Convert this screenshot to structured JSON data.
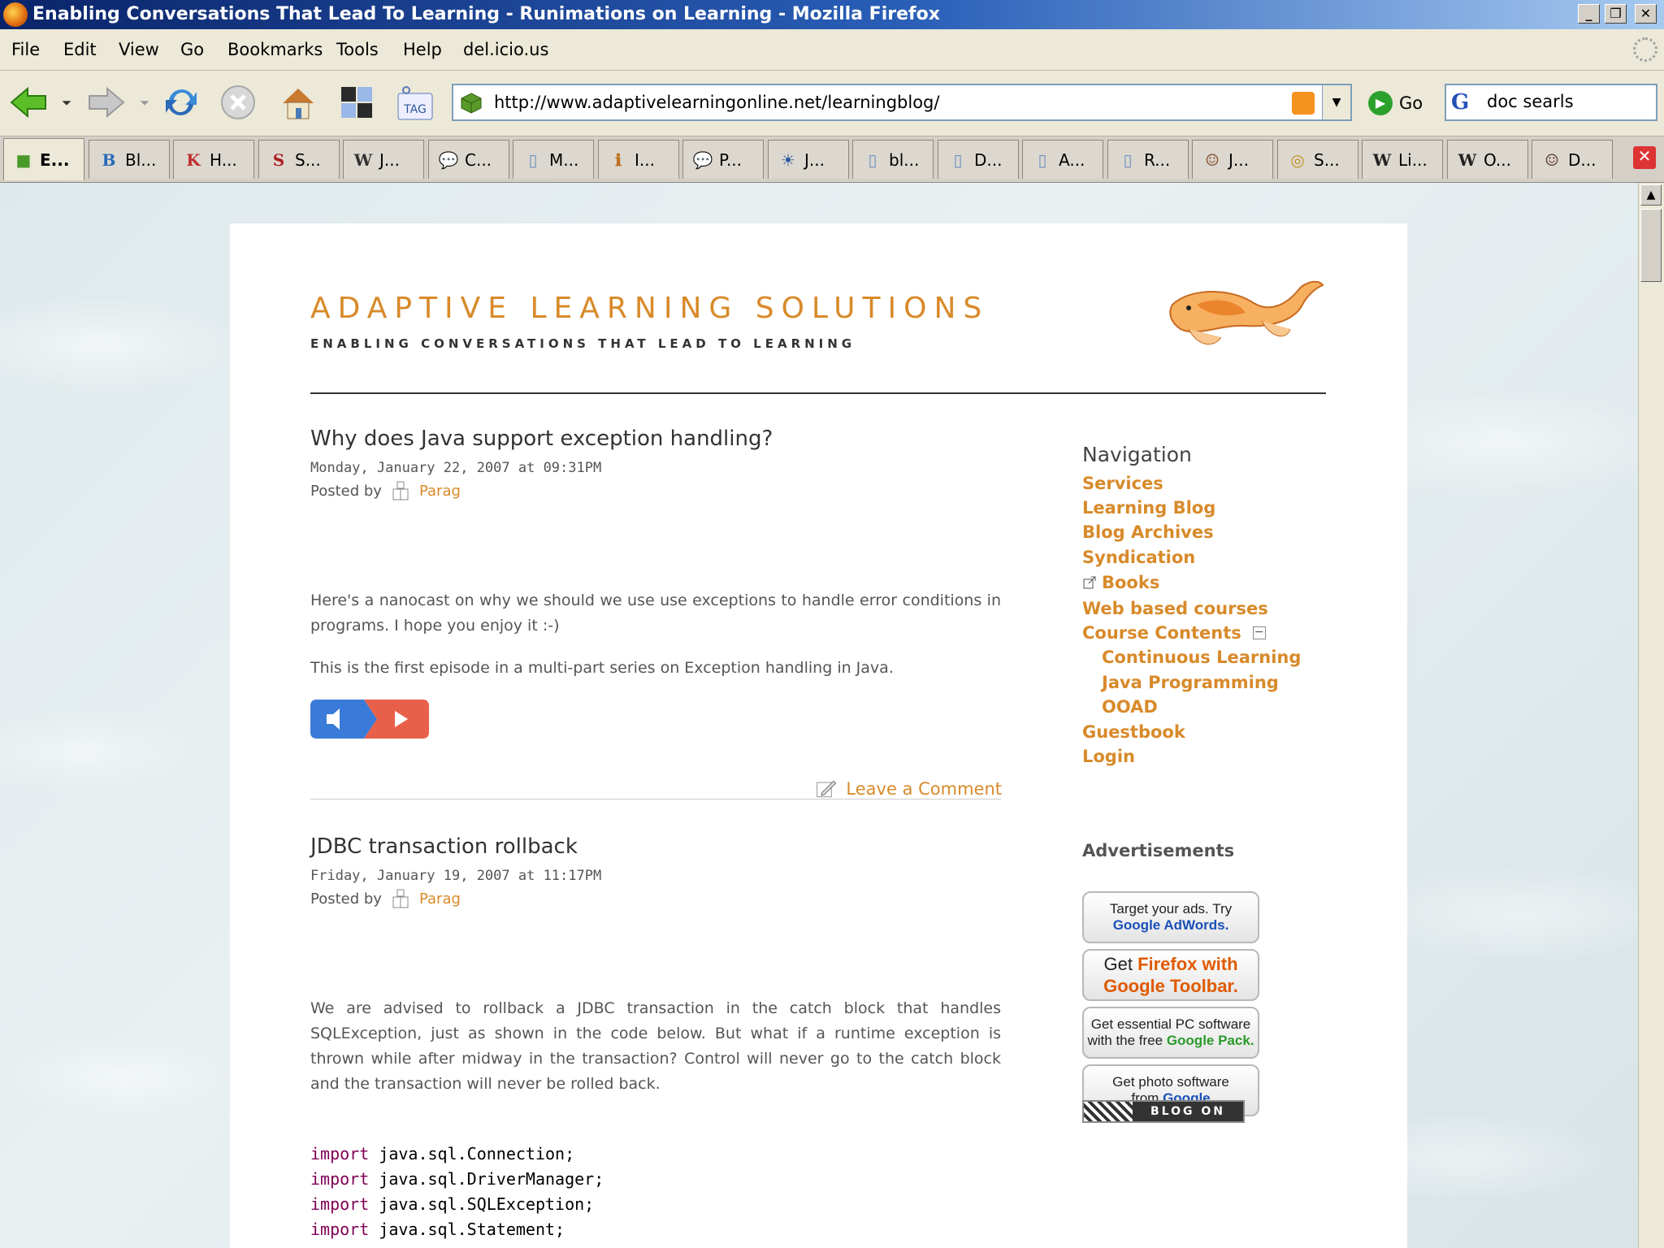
{
  "window": {
    "title": "Enabling Conversations That Lead To Learning - Runimations on Learning - Mozilla Firefox",
    "minimize": "_",
    "maximize": "❐",
    "close": "✕"
  },
  "menu": [
    "File",
    "Edit",
    "View",
    "Go",
    "Bookmarks",
    "Tools",
    "Help",
    "del.icio.us"
  ],
  "toolbar": {
    "url": "http://www.adaptivelearningonline.net/learningblog/",
    "go_label": "Go",
    "search_value": "doc searls",
    "tag_label": "TAG"
  },
  "tabs": [
    {
      "label": "E...",
      "icon": "cube-icon",
      "glyph": "■",
      "color": "#4a9a2a"
    },
    {
      "label": "Bl...",
      "icon": "blogger-b-icon",
      "glyph": "B",
      "color": "#2a6ab8"
    },
    {
      "label": "H...",
      "icon": "gk-icon",
      "glyph": "K",
      "color": "#c03030"
    },
    {
      "label": "S...",
      "icon": "s-logo-icon",
      "glyph": "S",
      "color": "#b02020"
    },
    {
      "label": "J...",
      "icon": "wordpress-icon",
      "glyph": "W",
      "color": "#333333"
    },
    {
      "label": "C...",
      "icon": "chat-bubble-icon",
      "glyph": "💬",
      "color": "#5a7ab8"
    },
    {
      "label": "M...",
      "icon": "page-icon",
      "glyph": "▯",
      "color": "#7090c0"
    },
    {
      "label": "I...",
      "icon": "info-icon",
      "glyph": "ℹ",
      "color": "#c07020"
    },
    {
      "label": "P...",
      "icon": "chat-bubble-icon",
      "glyph": "💬",
      "color": "#5a7ab8"
    },
    {
      "label": "J...",
      "icon": "sun-icon",
      "glyph": "☀",
      "color": "#2a5a9a"
    },
    {
      "label": "bl...",
      "icon": "page-icon",
      "glyph": "▯",
      "color": "#7090c0"
    },
    {
      "label": "D...",
      "icon": "page-icon",
      "glyph": "▯",
      "color": "#7090c0"
    },
    {
      "label": "A...",
      "icon": "page-icon",
      "glyph": "▯",
      "color": "#7090c0"
    },
    {
      "label": "R...",
      "icon": "page-icon",
      "glyph": "▯",
      "color": "#7090c0"
    },
    {
      "label": "J...",
      "icon": "portrait-icon",
      "glyph": "☺",
      "color": "#8a5a3a"
    },
    {
      "label": "S...",
      "icon": "signal-icon",
      "glyph": "◎",
      "color": "#c09020"
    },
    {
      "label": "Li...",
      "icon": "wikipedia-icon",
      "glyph": "W",
      "color": "#222222"
    },
    {
      "label": "O...",
      "icon": "wikipedia-icon",
      "glyph": "W",
      "color": "#222222"
    },
    {
      "label": "D...",
      "icon": "portrait-icon",
      "glyph": "☺",
      "color": "#6a4a3a"
    }
  ],
  "site": {
    "title": "ADAPTIVE LEARNING SOLUTIONS",
    "tagline": "ENABLING CONVERSATIONS THAT LEAD TO LEARNING"
  },
  "posts": [
    {
      "title": "Why does Java support exception handling?",
      "date": "Monday, January 22, 2007 at 09:31PM",
      "posted_by": "Posted by",
      "author": "Parag",
      "paragraphs": [
        "Here's a nanocast on why we should we use use exceptions to handle error conditions in programs. I hope you enjoy it :-)",
        "This is the first episode in a multi-part series on Exception handling in Java."
      ],
      "comment_link": "Leave a Comment"
    },
    {
      "title": "JDBC transaction rollback",
      "date": "Friday, January 19, 2007 at 11:17PM",
      "posted_by": "Posted by",
      "author": "Parag",
      "paragraphs": [
        "We are advised to rollback a JDBC transaction in the catch block that handles SQLException, just as shown in the code below. But what if a runtime exception is thrown while after midway in the transaction? Control will never go to the catch block and the transaction will never be rolled back."
      ],
      "code": [
        {
          "kw": "import",
          "rest": " java.sql.Connection;"
        },
        {
          "kw": "import",
          "rest": " java.sql.DriverManager;"
        },
        {
          "kw": "import",
          "rest": " java.sql.SQLException;"
        },
        {
          "kw": "import",
          "rest": " java.sql.Statement;"
        }
      ]
    }
  ],
  "sidebar": {
    "nav_heading": "Navigation",
    "nav_items": [
      "Services",
      "Learning Blog",
      "Blog Archives",
      "Syndication",
      "Books",
      "Web based courses",
      "Course Contents",
      "Continuous Learning",
      "Java Programming",
      "OOAD",
      "Guestbook",
      "Login"
    ],
    "ads_heading": "Advertisements",
    "ads": [
      {
        "line1": "Target your ads. Try",
        "line2": "Google AdWords."
      },
      {
        "line1a": "Get ",
        "line1b": "Firefox with",
        "line2": "Google Toolbar."
      },
      {
        "line1": "Get essential PC software",
        "line2a": "with the free ",
        "line2b": "Google Pack."
      },
      {
        "line1": "Get photo software",
        "line2a": "from ",
        "line2b": "Google"
      }
    ],
    "badge": "BLOG ON"
  },
  "colors": {
    "accent": "#d88a2a",
    "titlebar": "#0a246a",
    "text": "#555555"
  }
}
